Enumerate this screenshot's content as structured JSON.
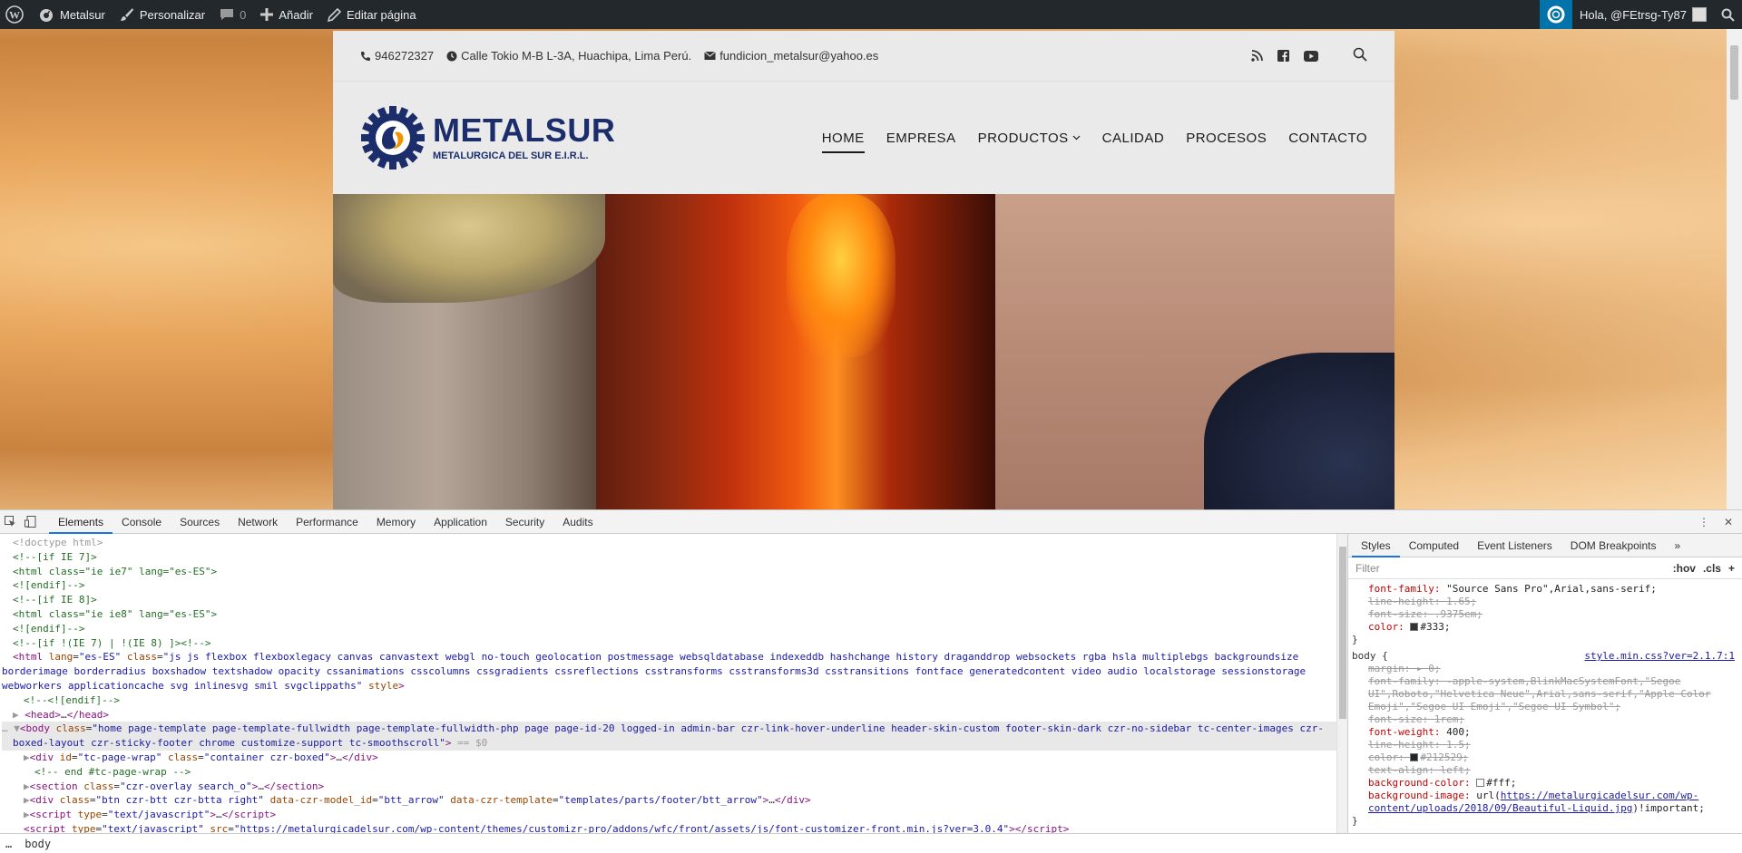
{
  "adminbar": {
    "site_name": "Metalsur",
    "customize": "Personalizar",
    "comments_count": "0",
    "add": "Añadir",
    "edit_page": "Editar página",
    "greeting": "Hola, @FEtrsg-Ty87"
  },
  "topbar": {
    "phone": "946272327",
    "address": "Calle Tokio M-B L-3A, Huachipa, Lima Perú.",
    "email": "fundicion_metalsur@yahoo.es"
  },
  "logo": {
    "title": "METALSUR",
    "subtitle": "METALURGICA DEL SUR E.I.R.L."
  },
  "nav": [
    {
      "label": "HOME"
    },
    {
      "label": "EMPRESA"
    },
    {
      "label": "PRODUCTOS"
    },
    {
      "label": "CALIDAD"
    },
    {
      "label": "PROCESOS"
    },
    {
      "label": "CONTACTO"
    }
  ],
  "devtools": {
    "tabs": [
      "Elements",
      "Console",
      "Sources",
      "Network",
      "Performance",
      "Memory",
      "Application",
      "Security",
      "Audits"
    ],
    "styles_tabs": [
      "Styles",
      "Computed",
      "Event Listeners",
      "DOM Breakpoints"
    ],
    "filter_placeholder": "Filter",
    "hov": ":hov",
    "cls": ".cls",
    "breadcrumb": "body"
  },
  "colors": {
    "adminbar_bg": "#23282d",
    "brand_blue": "#1b2d6b",
    "brand_orange": "#f39200",
    "devtools_accent": "#1a73e8"
  }
}
